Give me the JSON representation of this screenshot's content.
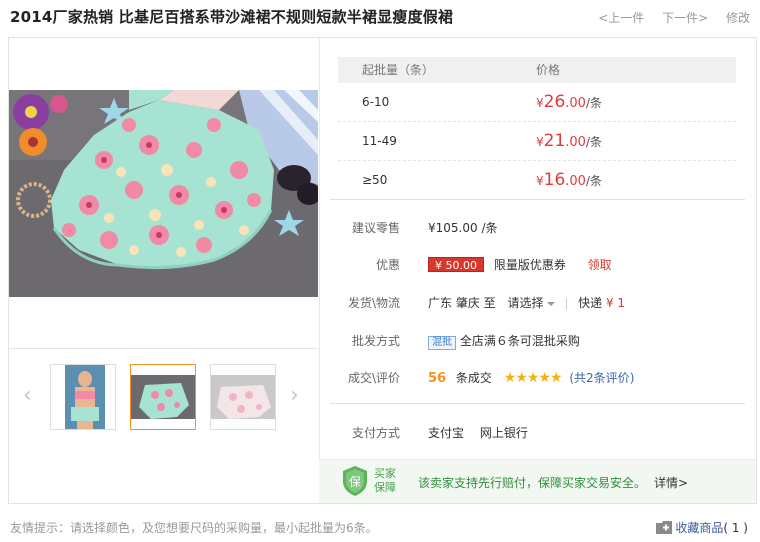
{
  "header": {
    "title": "2014厂家热销 比基尼百搭系带沙滩裙不规则短款半裙显瘦度假裙",
    "prev": "<上一件",
    "next": "下一件>",
    "edit": "修改"
  },
  "price_table": {
    "col_qty": "起批量（条）",
    "col_price": "价格",
    "rows": [
      {
        "qty": "6-10",
        "yen": "¥",
        "int": "26",
        "dec": ".00",
        "unit": "/条"
      },
      {
        "qty": "11-49",
        "yen": "¥",
        "int": "21",
        "dec": ".00",
        "unit": "/条"
      },
      {
        "qty": "≥50",
        "yen": "¥",
        "int": "16",
        "dec": ".00",
        "unit": "/条"
      }
    ]
  },
  "retail": {
    "label": "建议零售",
    "value": "¥105.00 /条"
  },
  "discount": {
    "label": "优惠",
    "coupon": "¥ 50.00",
    "desc": "限量版优惠券",
    "claim": "领取"
  },
  "shipping": {
    "label": "发货\\物流",
    "from": "广东 肇庆 至",
    "select": "请选择",
    "method": "快递",
    "price": "¥ 1"
  },
  "wholesale": {
    "label": "批发方式",
    "tag": "混批",
    "desc": "全店满６条可混批采购"
  },
  "deals": {
    "label": "成交\\评价",
    "count": "56",
    "count_suffix": "条成交",
    "stars": "★★★★★",
    "reviews_open": "(",
    "reviews": "共2条评价",
    "reviews_close": ")"
  },
  "payment": {
    "label": "支付方式",
    "methods": [
      "支付宝",
      "网上银行"
    ]
  },
  "guarantee": {
    "tag_line1": "买家",
    "tag_line2": "保障",
    "text": "该卖家支持先行赔付，保障买家交易安全。",
    "more": "详情>"
  },
  "footer": {
    "tip": "友情提示：请选择颜色，及您想要尺码的采购量，最小起批量为6条。",
    "fav_label": "收藏商品",
    "fav_count": "( 1 )"
  },
  "colors": {
    "accent_red": "#e4393c",
    "orange": "#f7931e",
    "green": "#2f8f3e"
  }
}
